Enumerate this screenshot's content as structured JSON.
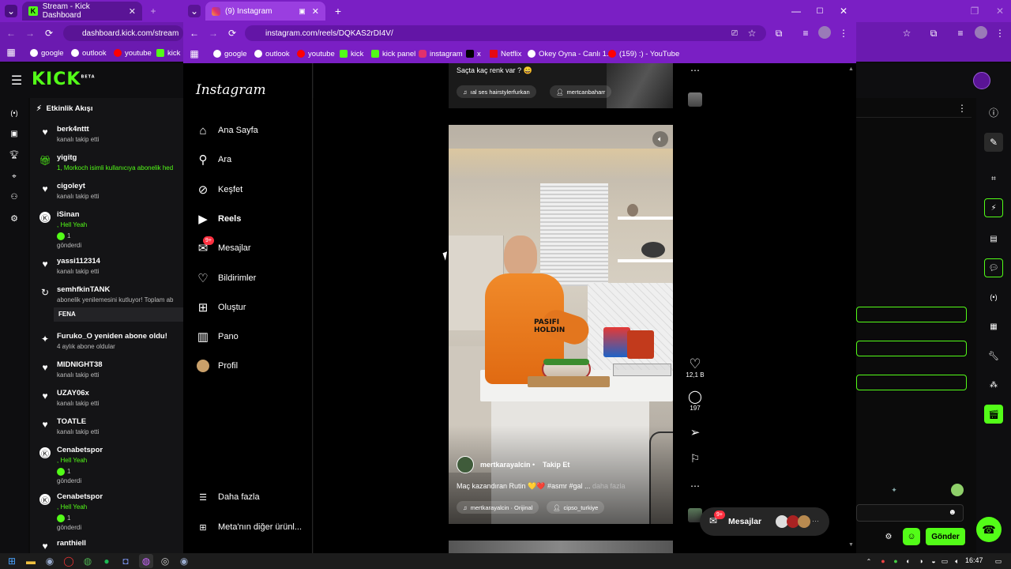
{
  "colors": {
    "browser_purple": "#7a1fc4",
    "kick_green": "#53fc18",
    "ig_heart_red": "#ff3040"
  },
  "back_browser": {
    "tab_title": "Stream - Kick Dashboard",
    "url": "dashboard.kick.com/stream",
    "bookmarks": [
      "google",
      "outlook",
      "youtube",
      "kick"
    ]
  },
  "front_browser": {
    "tab_title": "(9) Instagram",
    "url": "instagram.com/reels/DQKAS2rDI4V/",
    "bookmarks": [
      "google",
      "outlook",
      "youtube",
      "kick",
      "kick panel",
      "instagram",
      "x",
      "Netflix",
      "Okey Oyna - Canlı 1...",
      "(159) :) - YouTube"
    ]
  },
  "kick": {
    "logo": "KICK",
    "logo_badge": "BETA",
    "feed_title": "Etkinlik Akışı",
    "feed": [
      {
        "icon": "heart-icon",
        "name": "berk4nttt",
        "sub": "kanalı takip etti"
      },
      {
        "icon": "gift-icon",
        "name": "yigitg",
        "sub": "1, Morkoch isimli kullanıcıya abonelik hed",
        "sub_green": true
      },
      {
        "icon": "heart-icon",
        "name": "cigoleyt",
        "sub": "kanalı takip etti"
      },
      {
        "icon": "kick-coin-icon",
        "name": "iSinan",
        "sub": ", Hell Yeah",
        "sub_green": true,
        "extra": "1",
        "extra2": "gönderdi"
      },
      {
        "icon": "heart-icon",
        "name": "yassi112314",
        "sub": "kanalı takip etti"
      },
      {
        "icon": "refresh-icon",
        "name": "semhfkinTANK",
        "sub": "abonelik yenilemesini kutluyor! Toplam ab",
        "note": "FENA"
      },
      {
        "icon": "star-icon",
        "name": "Furuko_O yeniden abone oldu!",
        "sub": "4 aylık abone oldular"
      },
      {
        "icon": "heart-icon",
        "name": "MIDNIGHT38",
        "sub": "kanalı takip etti"
      },
      {
        "icon": "heart-icon",
        "name": "UZAY06x",
        "sub": "kanalı takip etti"
      },
      {
        "icon": "heart-icon",
        "name": "TOATLE",
        "sub": "kanalı takip etti"
      },
      {
        "icon": "kick-coin-icon",
        "name": "Cenabetspor",
        "sub": ", Hell Yeah",
        "sub_green": true,
        "extra": "1",
        "extra2": "gönderdi"
      },
      {
        "icon": "kick-coin-icon",
        "name": "Cenabetspor",
        "sub": ", Hell Yeah",
        "sub_green": true,
        "extra": "1",
        "extra2": "gönderdi"
      },
      {
        "icon": "heart-icon",
        "name": "ranthiell",
        "sub": ""
      }
    ],
    "send_button": "Gönder"
  },
  "instagram": {
    "logo": "Instagram",
    "nav": [
      {
        "icon": "home-icon",
        "label": "Ana Sayfa"
      },
      {
        "icon": "search-icon",
        "label": "Ara"
      },
      {
        "icon": "compass-icon",
        "label": "Keşfet"
      },
      {
        "icon": "reels-icon",
        "label": "Reels",
        "active": true
      },
      {
        "icon": "messenger-icon",
        "label": "Mesajlar",
        "badge": "9+"
      },
      {
        "icon": "heart-icon",
        "label": "Bildirimler"
      },
      {
        "icon": "plus-square-icon",
        "label": "Oluştur"
      },
      {
        "icon": "dashboard-icon",
        "label": "Pano"
      },
      {
        "icon": "avatar",
        "label": "Profil"
      }
    ],
    "more": "Daha fazla",
    "meta": "Meta'nın diğer ürünl...",
    "prev_reel": {
      "caption": "Saçta kaç renk var ? 😄",
      "audio": "ıal ses  hairstylerfurkan",
      "tag": "mertcanbaharr"
    },
    "reel": {
      "author": "mertkarayalcin",
      "follow": "Takip Et",
      "caption": "Maç kazandıran Rutin 💛❤️ #asmr #gal ... ",
      "more": "daha fazla",
      "audio": "mertkarayalcin · Orijinal",
      "tag": "cipso_turkiye",
      "likes": "12,1 B",
      "comments": "197"
    },
    "messages_pill": "Mesajlar",
    "messages_badge": "9+"
  },
  "taskbar": {
    "time": "16:47"
  }
}
